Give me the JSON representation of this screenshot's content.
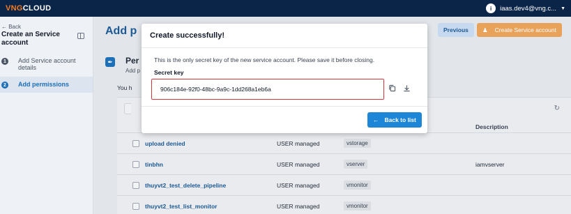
{
  "brand": {
    "logo_part1": "VNG",
    "logo_part2": "CLOUD"
  },
  "user": {
    "initial": "i",
    "email": "iaas.dev4@vng.c..."
  },
  "sidebar": {
    "back_label": "← Back",
    "title": "Create an Service account",
    "steps": [
      {
        "number": "1",
        "label": "Add Service account details"
      },
      {
        "number": "2",
        "label": "Add permissions"
      }
    ]
  },
  "header": {
    "title": "Add p",
    "previous_label": "Previous",
    "create_label": "Create Service account"
  },
  "section": {
    "title": "Per",
    "subtitle": "Add p",
    "you_have": "You h"
  },
  "table": {
    "description_header": "Description",
    "rows": [
      {
        "name": "upload denied",
        "type": "USER managed",
        "service": "vstorage",
        "description": ""
      },
      {
        "name": "tinbhn",
        "type": "USER managed",
        "service": "vserver",
        "description": "iamvserver"
      },
      {
        "name": "thuyvt2_test_delete_pipeline",
        "type": "USER managed",
        "service": "vmonitor",
        "description": ""
      },
      {
        "name": "thuyvt2_test_list_monitor",
        "type": "USER managed",
        "service": "vmonitor",
        "description": ""
      }
    ]
  },
  "modal": {
    "title": "Create successfully!",
    "message": "This is the only secret key of the new service account. Please save it before closing.",
    "secret_label": "Secret key",
    "secret_value": "906c184e-92f0-48bc-9a9c-1dd268a1eb6a",
    "back_button": "Back to list"
  },
  "colors": {
    "accent": "#1d86d6",
    "brand_orange": "#f47b20",
    "topbar": "#0b2548",
    "error_border": "#d9363e"
  }
}
